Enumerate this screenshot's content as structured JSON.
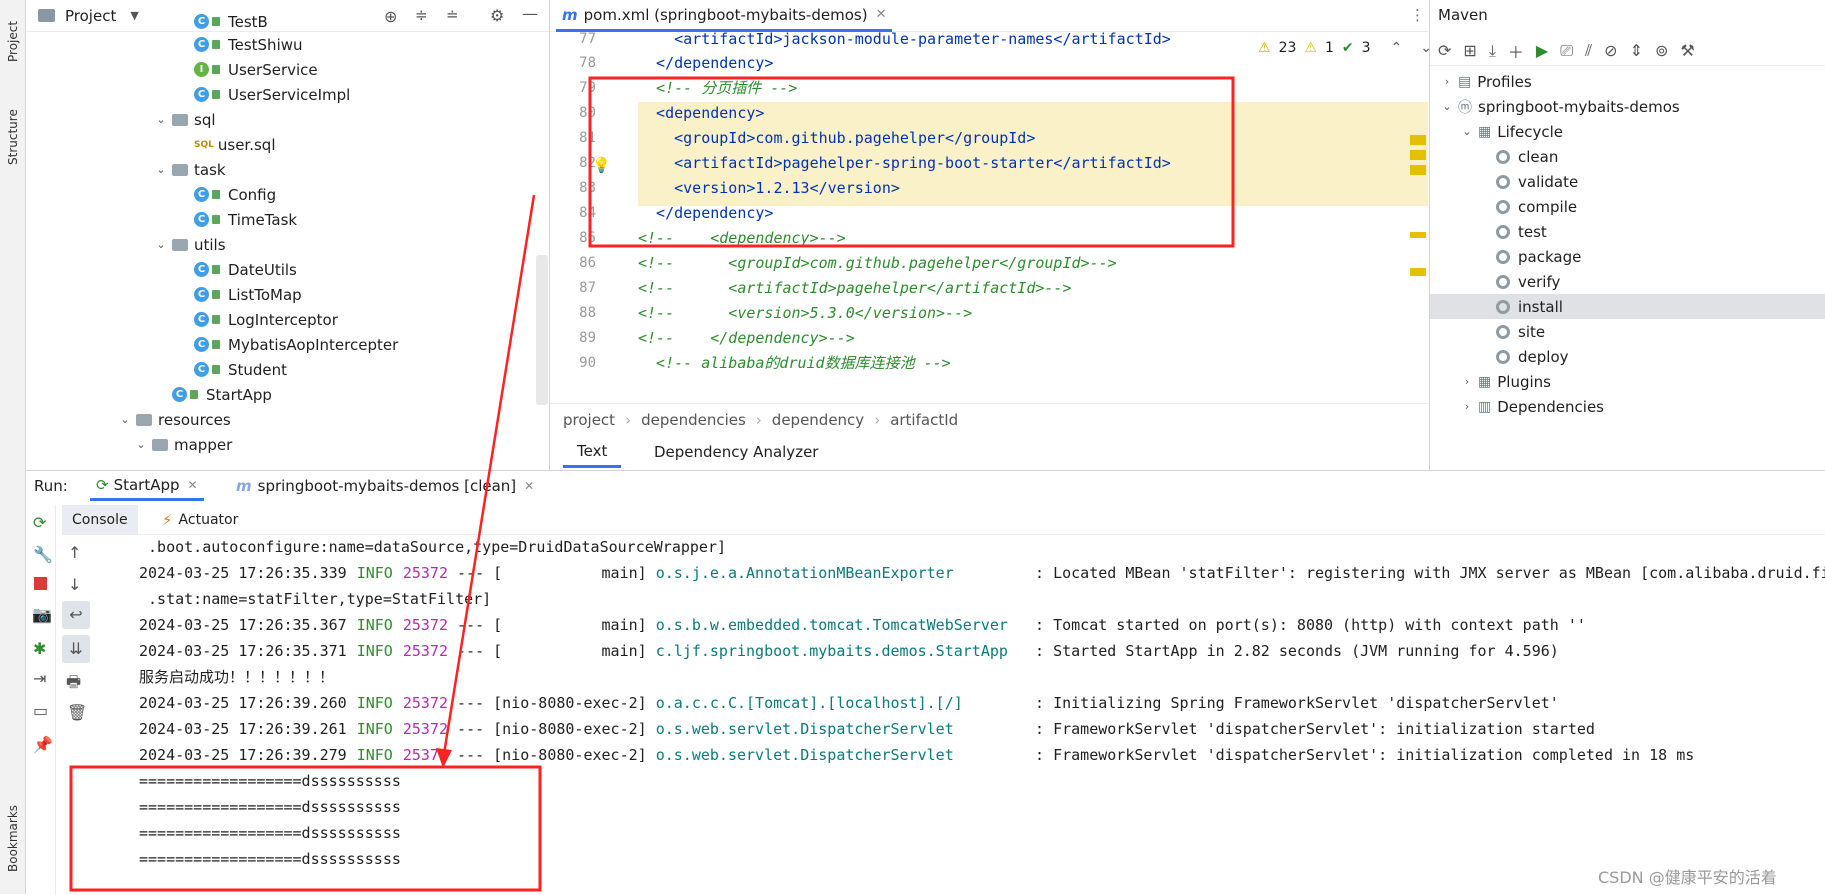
{
  "left_strip": {
    "project": "Project",
    "structure": "Structure",
    "bookmarks": "Bookmarks"
  },
  "project_panel": {
    "title": "Project",
    "items": [
      {
        "label": "TestB",
        "kind": "class",
        "indent": 1
      },
      {
        "label": "TestShiwu",
        "kind": "class",
        "indent": 1
      },
      {
        "label": "UserService",
        "kind": "interface",
        "indent": 1
      },
      {
        "label": "UserServiceImpl",
        "kind": "class",
        "indent": 1
      },
      {
        "label": "sql",
        "kind": "folder",
        "indent": 0
      },
      {
        "label": "user.sql",
        "kind": "sql",
        "indent": 1
      },
      {
        "label": "task",
        "kind": "folder",
        "indent": 0
      },
      {
        "label": "Config",
        "kind": "class",
        "indent": 1
      },
      {
        "label": "TimeTask",
        "kind": "class",
        "indent": 1
      },
      {
        "label": "utils",
        "kind": "folder",
        "indent": 0
      },
      {
        "label": "DateUtils",
        "kind": "class",
        "indent": 1
      },
      {
        "label": "ListToMap",
        "kind": "class",
        "indent": 1
      },
      {
        "label": "LogInterceptor",
        "kind": "class",
        "indent": 1
      },
      {
        "label": "MybatisAopIntercepter",
        "kind": "class",
        "indent": 1
      },
      {
        "label": "Student",
        "kind": "class",
        "indent": 1
      },
      {
        "label": "StartApp",
        "kind": "app",
        "indent": -1
      },
      {
        "label": "resources",
        "kind": "folder",
        "indent": -2
      },
      {
        "label": "mapper",
        "kind": "folder",
        "indent": -3
      }
    ]
  },
  "editor": {
    "tab": "pom.xml (springboot-mybaits-demos)",
    "warnings": "23",
    "weak_warnings": "1",
    "checks": "3",
    "lines": [
      {
        "n": "77",
        "html": "    <artifactId>jackson-module-parameter-names</artifactId>"
      },
      {
        "n": "78",
        "html": "  </dependency>"
      },
      {
        "n": "79",
        "html": "  <!-- 分页插件 -->"
      },
      {
        "n": "80",
        "html": "  <dependency>"
      },
      {
        "n": "81",
        "html": "    <groupId>com.github.pagehelper</groupId>"
      },
      {
        "n": "82",
        "html": "    <artifactId>pagehelper-spring-boot-starter</artifactId>"
      },
      {
        "n": "83",
        "html": "    <version>1.2.13</version>"
      },
      {
        "n": "84",
        "html": "  </dependency>"
      },
      {
        "n": "85",
        "html": "<!--    <dependency>-->"
      },
      {
        "n": "86",
        "html": "<!--      <groupId>com.github.pagehelper</groupId>-->"
      },
      {
        "n": "87",
        "html": "<!--      <artifactId>pagehelper</artifactId>-->"
      },
      {
        "n": "88",
        "html": "<!--      <version>5.3.0</version>-->"
      },
      {
        "n": "89",
        "html": "<!--    </dependency>-->"
      },
      {
        "n": "90",
        "html": "  <!-- alibaba的druid数据库连接池 -->"
      }
    ],
    "breadcrumb": [
      "project",
      "dependencies",
      "dependency",
      "artifactId"
    ],
    "bottom_tabs": [
      "Text",
      "Dependency Analyzer"
    ]
  },
  "maven": {
    "title": "Maven",
    "profiles": "Profiles",
    "project": "springboot-mybaits-demos",
    "lifecycle": "Lifecycle",
    "phases": [
      "clean",
      "validate",
      "compile",
      "test",
      "package",
      "verify",
      "install",
      "site",
      "deploy"
    ],
    "plugins": "Plugins",
    "dependencies": "Dependencies"
  },
  "run": {
    "label": "Run:",
    "tab1": "StartApp",
    "tab2": "springboot-mybaits-demos [clean]",
    "console": "Console",
    "actuator": "Actuator",
    "lines": [
      {
        "plain": " .boot.autoconfigure:name=dataSource,type=DruidDataSourceWrapper]"
      },
      {
        "date": "2024-03-25 17:26:35.339",
        "level": "INFO",
        "pid": "25372",
        "mid": " --- [           main] ",
        "logger": "o.s.j.e.a.AnnotationMBeanExporter        ",
        "msg": " : Located MBean 'statFilter': registering with JMX server as MBean [com.alibaba.druid.filter"
      },
      {
        "plain": " .stat:name=statFilter,type=StatFilter]"
      },
      {
        "date": "2024-03-25 17:26:35.367",
        "level": "INFO",
        "pid": "25372",
        "mid": " --- [           main] ",
        "logger": "o.s.b.w.embedded.tomcat.TomcatWebServer  ",
        "msg": " : Tomcat started on port(s): 8080 (http) with context path ''"
      },
      {
        "date": "2024-03-25 17:26:35.371",
        "level": "INFO",
        "pid": "25372",
        "mid": " --- [           main] ",
        "logger": "c.ljf.springboot.mybaits.demos.StartApp  ",
        "msg": " : Started StartApp in 2.82 seconds (JVM running for 4.596)"
      },
      {
        "plain": "服务启动成功！！！！！！！"
      },
      {
        "date": "2024-03-25 17:26:39.260",
        "level": "INFO",
        "pid": "25372",
        "mid": " --- [nio-8080-exec-2] ",
        "logger": "o.a.c.c.C.[Tomcat].[localhost].[/]       ",
        "msg": " : Initializing Spring FrameworkServlet 'dispatcherServlet'"
      },
      {
        "date": "2024-03-25 17:26:39.261",
        "level": "INFO",
        "pid": "25372",
        "mid": " --- [nio-8080-exec-2] ",
        "logger": "o.s.web.servlet.DispatcherServlet        ",
        "msg": " : FrameworkServlet 'dispatcherServlet': initialization started"
      },
      {
        "date": "2024-03-25 17:26:39.279",
        "level": "INFO",
        "pid": "25372",
        "mid": " --- [nio-8080-exec-2] ",
        "logger": "o.s.web.servlet.DispatcherServlet        ",
        "msg": " : FrameworkServlet 'dispatcherServlet': initialization completed in 18 ms"
      },
      {
        "plain": "==================dssssssssss"
      },
      {
        "plain": "==================dssssssssss"
      },
      {
        "plain": "==================dssssssssss"
      },
      {
        "plain": "==================dssssssssss"
      }
    ]
  },
  "watermark": "CSDN @健康平安的活着",
  "colors": {
    "highlight": "#fbf1c9",
    "red": "#ff2222",
    "tag": "#0033b3",
    "comment": "#2d8c2d",
    "info": "#2d8c2d",
    "pid": "#b12cb1",
    "logger": "#0a7a7a"
  }
}
